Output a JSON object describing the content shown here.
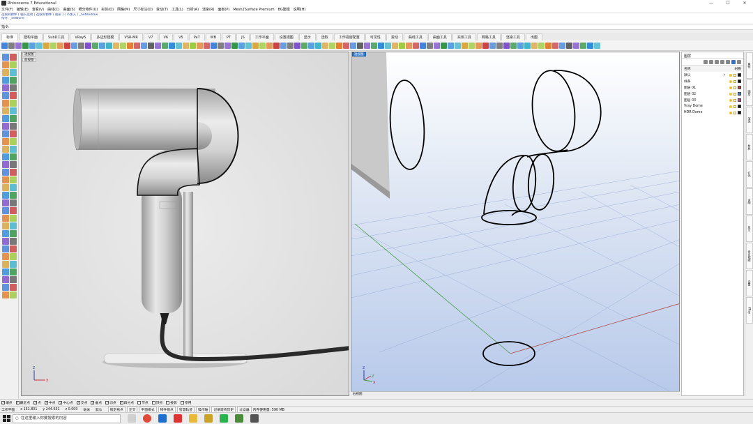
{
  "window": {
    "title": "Rhinoceros 7 Educational",
    "controls": [
      "—",
      "☐",
      "✕"
    ]
  },
  "menu": [
    "文件(F)",
    "编辑(E)",
    "查看(V)",
    "曲线(C)",
    "曲面(S)",
    "细分物件(U)",
    "实体(O)",
    "网格(M)",
    "尺寸标注(D)",
    "变动(T)",
    "工具(L)",
    "分析(A)",
    "渲染(R)",
    "面板(P)",
    "Mesh2Surface Premium",
    "BG建模",
    "说明(H)"
  ],
  "command": {
    "history": [
      "选取的物件 ( 输入选项 ) 选取的物件 ( 矩形 ) ( 不加入 ) _SetRedraw",
      "指令: _SelNone"
    ],
    "prompt": "指令:"
  },
  "tabs": [
    "标准",
    "建构平面",
    "SubD工具",
    "VRay5",
    "多边形建模",
    "VSR-MR",
    "V7",
    "V6",
    "V5",
    "PaT",
    "WB",
    "PT",
    "JS",
    "工作平面",
    "设置视图",
    "显示",
    "选取",
    "工作视窗配置",
    "可见性",
    "变动",
    "曲线工具",
    "曲面工具",
    "实体工具",
    "网格工具",
    "渲染工具",
    "出图"
  ],
  "viewports": {
    "left": {
      "label": "透视图",
      "sub_label": "前视图"
    },
    "right": {
      "label": "透视图"
    }
  },
  "viewtabs": {
    "active": "右视图"
  },
  "layers_panel": {
    "title": "图层",
    "columns": [
      "名称",
      "材质"
    ],
    "rows": [
      {
        "name": "默认",
        "current": "✓",
        "color": "#111111"
      },
      {
        "name": "线条",
        "current": "",
        "color": "#111111"
      },
      {
        "name": "图层 01",
        "current": "",
        "color": "#d83a3a"
      },
      {
        "name": "图层 02",
        "current": "",
        "color": "#2a86d8"
      },
      {
        "name": "图层 03",
        "current": "",
        "color": "#d832a6"
      },
      {
        "name": "Vray Dome",
        "current": "",
        "color": "#111111"
      },
      {
        "name": "HDR Dome",
        "current": "",
        "color": "#111111"
      }
    ]
  },
  "side_tabs": [
    "属性",
    "图层",
    "渲染",
    "材质",
    "灯光",
    "说明",
    "显示",
    "命名视图",
    "设置",
    "VRay"
  ],
  "osnap": [
    {
      "label": "端点",
      "checked": true
    },
    {
      "label": "最近点",
      "checked": true
    },
    {
      "label": "点",
      "checked": true
    },
    {
      "label": "中点",
      "checked": true
    },
    {
      "label": "中心点",
      "checked": true
    },
    {
      "label": "交点",
      "checked": true
    },
    {
      "label": "垂点",
      "checked": true
    },
    {
      "label": "切点",
      "checked": true
    },
    {
      "label": "四分点",
      "checked": true
    },
    {
      "label": "节点",
      "checked": false
    },
    {
      "label": "顶点",
      "checked": false
    },
    {
      "label": "投影",
      "checked": false
    },
    {
      "label": "停用",
      "checked": false
    }
  ],
  "status": {
    "cplane": "工作平面",
    "x": "x 151.801",
    "y": "y 244.631",
    "z": "z 0.000",
    "units": "毫米",
    "layer": "默认",
    "toggles": [
      "锁定格点",
      "正交",
      "平面模式",
      "物件锁点",
      "智慧轨迹",
      "操作轴",
      "记录建构历史",
      "过滤器"
    ],
    "memory": "内存使用量: 590 MB"
  },
  "taskbar": {
    "search_placeholder": "在这里输入你要搜索的内容"
  },
  "axis": {
    "x": "x",
    "y": "y",
    "z": "z"
  },
  "colors": {
    "accent": "#2f77c9",
    "grid": "#9aaed6",
    "x_axis": "#c0504d",
    "y_axis": "#4a9a4a"
  }
}
